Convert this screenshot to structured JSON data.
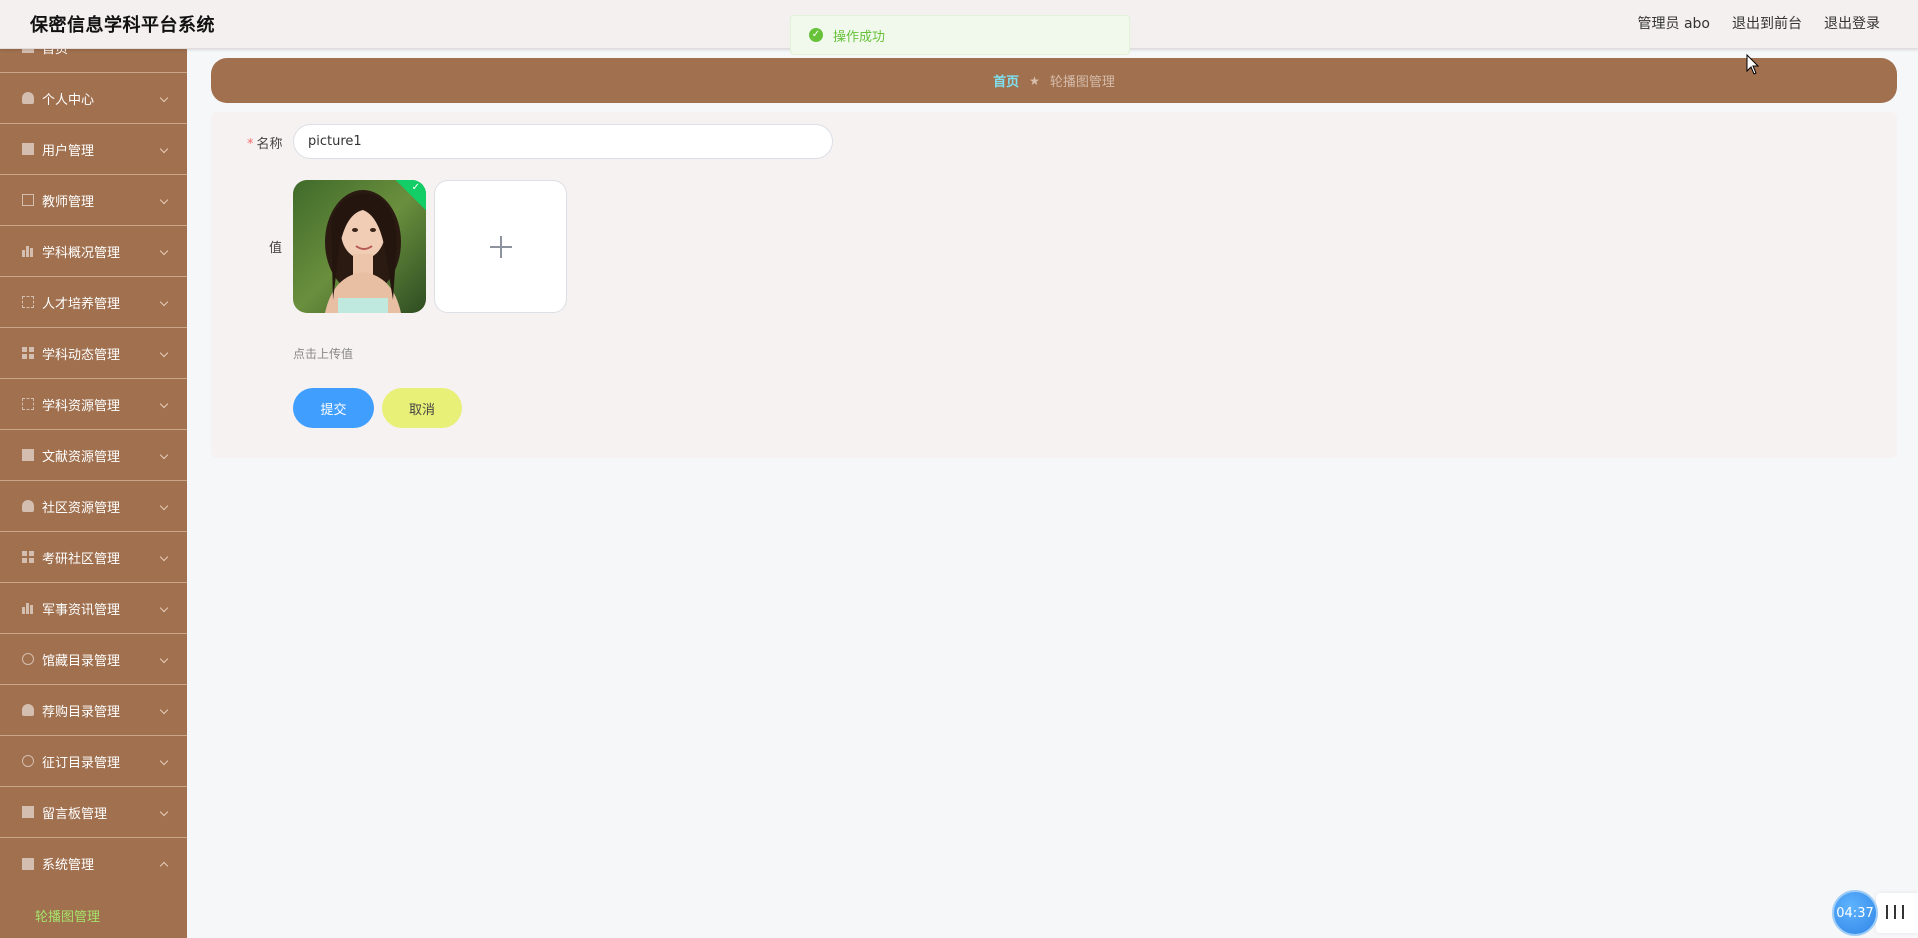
{
  "header": {
    "title": "保密信息学科平台系统",
    "user": "管理员 abo",
    "to_front": "退出到前台",
    "logout": "退出登录"
  },
  "toast": {
    "text": "操作成功",
    "icon": "check-circle-icon",
    "color": "#67c23a"
  },
  "sidebar": {
    "top_partial": "首页",
    "items": [
      {
        "label": "个人中心",
        "icon": "person-icon"
      },
      {
        "label": "用户管理",
        "icon": "clipboard-icon"
      },
      {
        "label": "教师管理",
        "icon": "mail-icon"
      },
      {
        "label": "学科概况管理",
        "icon": "bar-chart-icon"
      },
      {
        "label": "人才培养管理",
        "icon": "box-icon"
      },
      {
        "label": "学科动态管理",
        "icon": "grid-icon"
      },
      {
        "label": "学科资源管理",
        "icon": "frame-icon"
      },
      {
        "label": "文献资源管理",
        "icon": "thumb-icon"
      },
      {
        "label": "社区资源管理",
        "icon": "person-icon"
      },
      {
        "label": "考研社区管理",
        "icon": "grid-icon"
      },
      {
        "label": "军事资讯管理",
        "icon": "bar-chart-icon"
      },
      {
        "label": "馆藏目录管理",
        "icon": "power-icon"
      },
      {
        "label": "荐购目录管理",
        "icon": "location-icon"
      },
      {
        "label": "征订目录管理",
        "icon": "microphone-icon"
      },
      {
        "label": "留言板管理",
        "icon": "briefcase-icon"
      },
      {
        "label": "系统管理",
        "icon": "clipboard-icon"
      }
    ],
    "active_sub": "轮播图管理"
  },
  "breadcrumb": {
    "home": "首页",
    "separator": "★",
    "current": "轮播图管理"
  },
  "form": {
    "name_label": "名称",
    "name_value": "picture1",
    "value_label": "值",
    "upload_tip": "点击上传值",
    "submit": "提交",
    "cancel": "取消"
  },
  "timer": {
    "time": "04:37"
  },
  "colors": {
    "sidebar_bg": "#a0704f",
    "breadcrumb_bg": "#a0704f",
    "submit_bg": "#409eff",
    "cancel_bg": "#e9f077",
    "active_sub": "#a6e36b",
    "breadcrumb_home": "#7fe0f0"
  }
}
